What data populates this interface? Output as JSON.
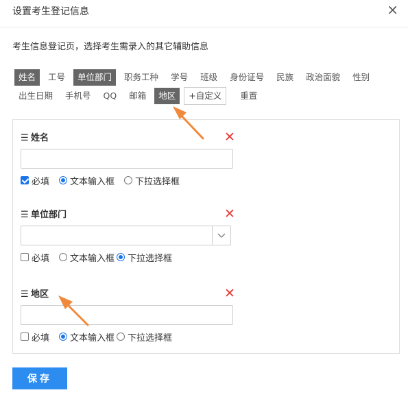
{
  "dialog": {
    "title": "设置考生登记信息",
    "close_icon": "×",
    "description": "考生信息登记页，选择考生需录入的其它辅助信息"
  },
  "tags_row1": [
    {
      "label": "姓名",
      "active": true
    },
    {
      "label": "工号",
      "active": false
    },
    {
      "label": "单位部门",
      "active": true
    },
    {
      "label": "职务工种",
      "active": false
    },
    {
      "label": "学号",
      "active": false
    },
    {
      "label": "班级",
      "active": false
    },
    {
      "label": "身份证号",
      "active": false
    },
    {
      "label": "民族",
      "active": false
    },
    {
      "label": "政治面貌",
      "active": false
    },
    {
      "label": "性别",
      "active": false
    }
  ],
  "tags_row2": [
    {
      "label": "出生日期",
      "active": false
    },
    {
      "label": "手机号",
      "active": false
    },
    {
      "label": "QQ",
      "active": false
    },
    {
      "label": "邮箱",
      "active": false
    },
    {
      "label": "地区",
      "active": true
    }
  ],
  "custom_button": "+自定义",
  "reset_button": "重置",
  "fields": [
    {
      "label": "姓名",
      "required": true,
      "type": "text",
      "required_label": "必填",
      "text_label": "文本输入框",
      "select_label": "下拉选择框"
    },
    {
      "label": "单位部门",
      "required": false,
      "type": "select",
      "required_label": "必填",
      "text_label": "文本输入框",
      "select_label": "下拉选择框"
    },
    {
      "label": "地区",
      "required": false,
      "type": "text",
      "required_label": "必填",
      "text_label": "文本输入框",
      "select_label": "下拉选择框"
    }
  ],
  "drag_icon": "☰",
  "delete_icon": "✕",
  "save_button": "保存",
  "colors": {
    "accent": "#2d8cf0",
    "tag_active": "#666666",
    "delete": "#e53935",
    "annotation_arrow": "#f0893c"
  }
}
